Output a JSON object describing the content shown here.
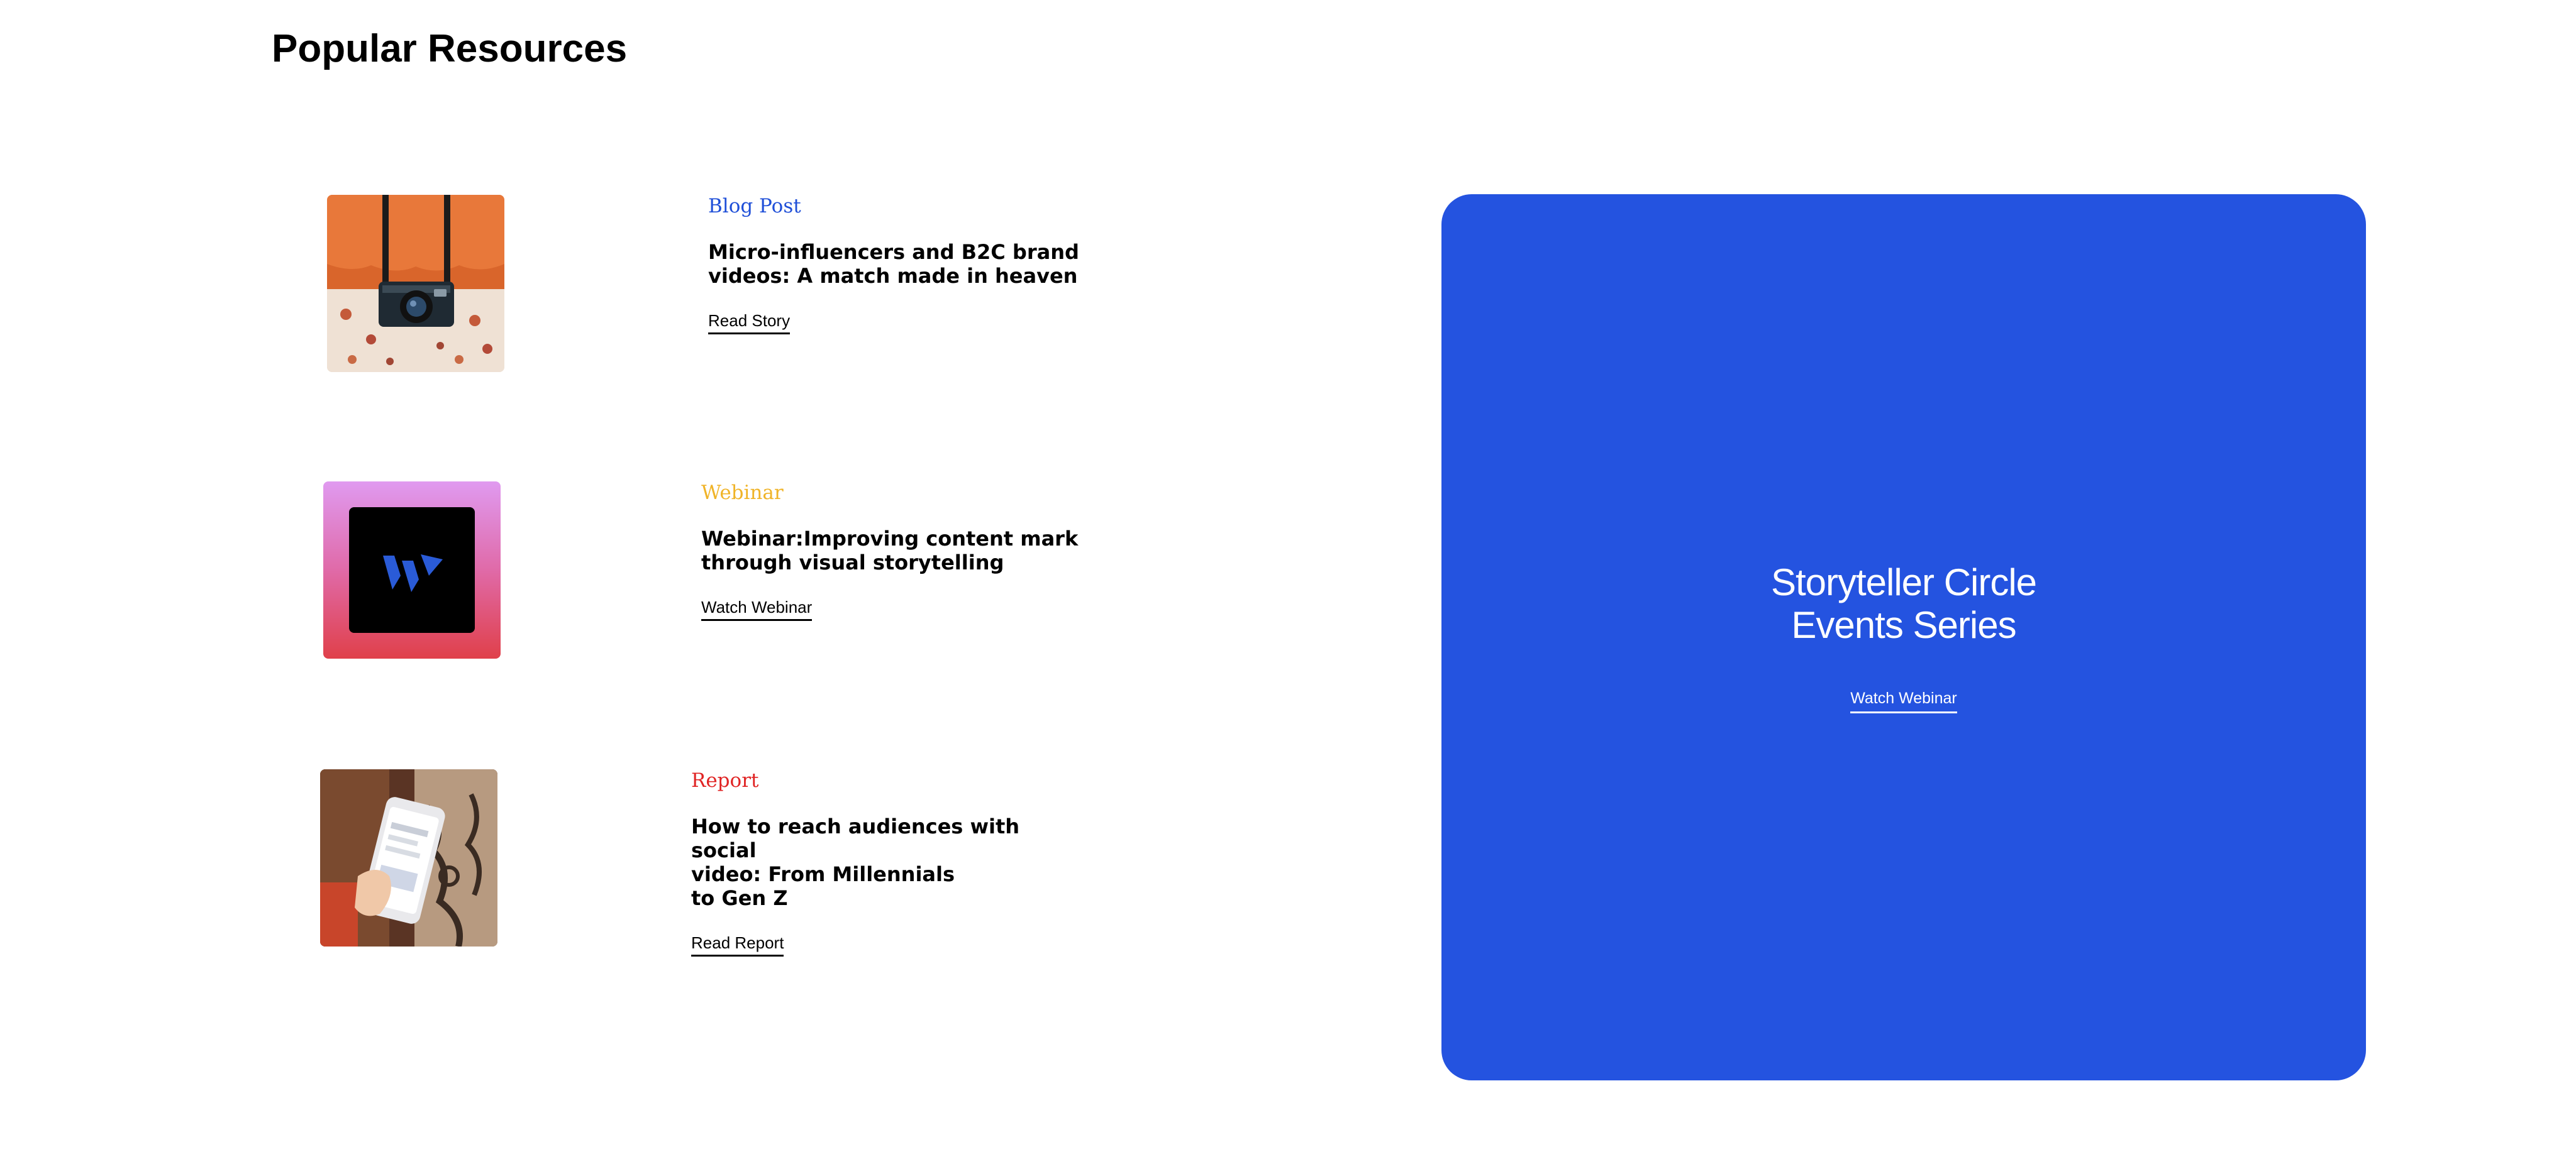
{
  "section": {
    "title": "Popular Resources"
  },
  "resources": [
    {
      "type": "Blog Post",
      "type_color": "#1f4fd8",
      "headline": "Micro-influencers and B2C brand\nvideos: A match made in heaven",
      "link": "Read Story",
      "thumbnail": "camera-strap-photo"
    },
    {
      "type": "Webinar",
      "type_color": "#f0b429",
      "headline": "Webinar:Improving content mark\nthrough visual storytelling",
      "link": "Watch Webinar",
      "thumbnail": "brand-logo-tile"
    },
    {
      "type": "Report",
      "type_color": "#e02424",
      "headline": "How to reach audiences with social\nvideo: From Millennials\nto Gen Z",
      "link": "Read Report",
      "thumbnail": "phone-in-hand-photo"
    }
  ],
  "promo": {
    "title": "Storyteller Circle\nEvents Series",
    "link": "Watch Webinar",
    "background": "#2453e0"
  }
}
